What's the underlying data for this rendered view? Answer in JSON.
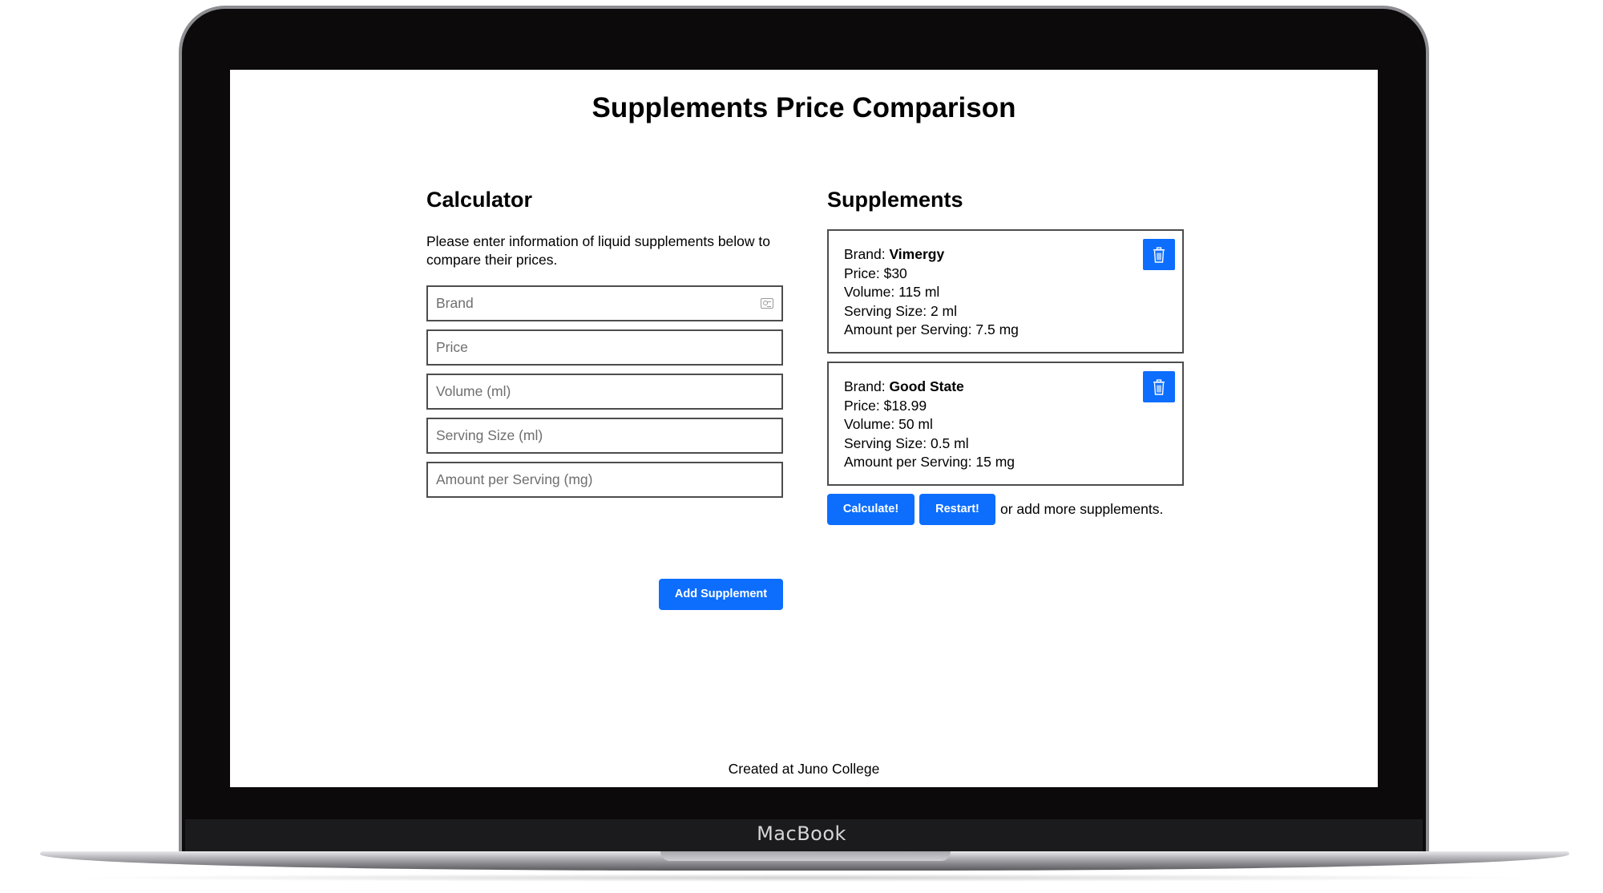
{
  "device": {
    "label": "MacBook"
  },
  "page": {
    "title": "Supplements Price Comparison",
    "footer": "Created at Juno College"
  },
  "calculator": {
    "title": "Calculator",
    "description": "Please enter information of liquid supplements below to compare their prices.",
    "fields": {
      "brand": {
        "placeholder": "Brand",
        "value": ""
      },
      "price": {
        "placeholder": "Price",
        "value": ""
      },
      "volume": {
        "placeholder": "Volume (ml)",
        "value": ""
      },
      "serving_size": {
        "placeholder": "Serving Size (ml)",
        "value": ""
      },
      "amount": {
        "placeholder": "Amount per Serving (mg)",
        "value": ""
      }
    },
    "add_button": "Add Supplement"
  },
  "supplements": {
    "title": "Supplements",
    "items": [
      {
        "brand_label": "Brand: ",
        "brand": "Vimergy",
        "price": "Price: $30",
        "volume": "Volume: 115 ml",
        "serving_size": "Serving Size: 2 ml",
        "amount": "Amount per Serving: 7.5 mg"
      },
      {
        "brand_label": "Brand: ",
        "brand": "Good State",
        "price": "Price: $18.99",
        "volume": "Volume: 50 ml",
        "serving_size": "Serving Size: 0.5 ml",
        "amount": "Amount per Serving: 15 mg"
      }
    ],
    "calculate_button": "Calculate!",
    "restart_button": "Restart!",
    "hint": "or add more supplements."
  },
  "colors": {
    "accent": "#0d6efd",
    "border": "#4d4d4d",
    "bezel": "#0c0a0a"
  },
  "icons": {
    "delete": "trash-icon",
    "autofill": "contact-card-icon"
  }
}
